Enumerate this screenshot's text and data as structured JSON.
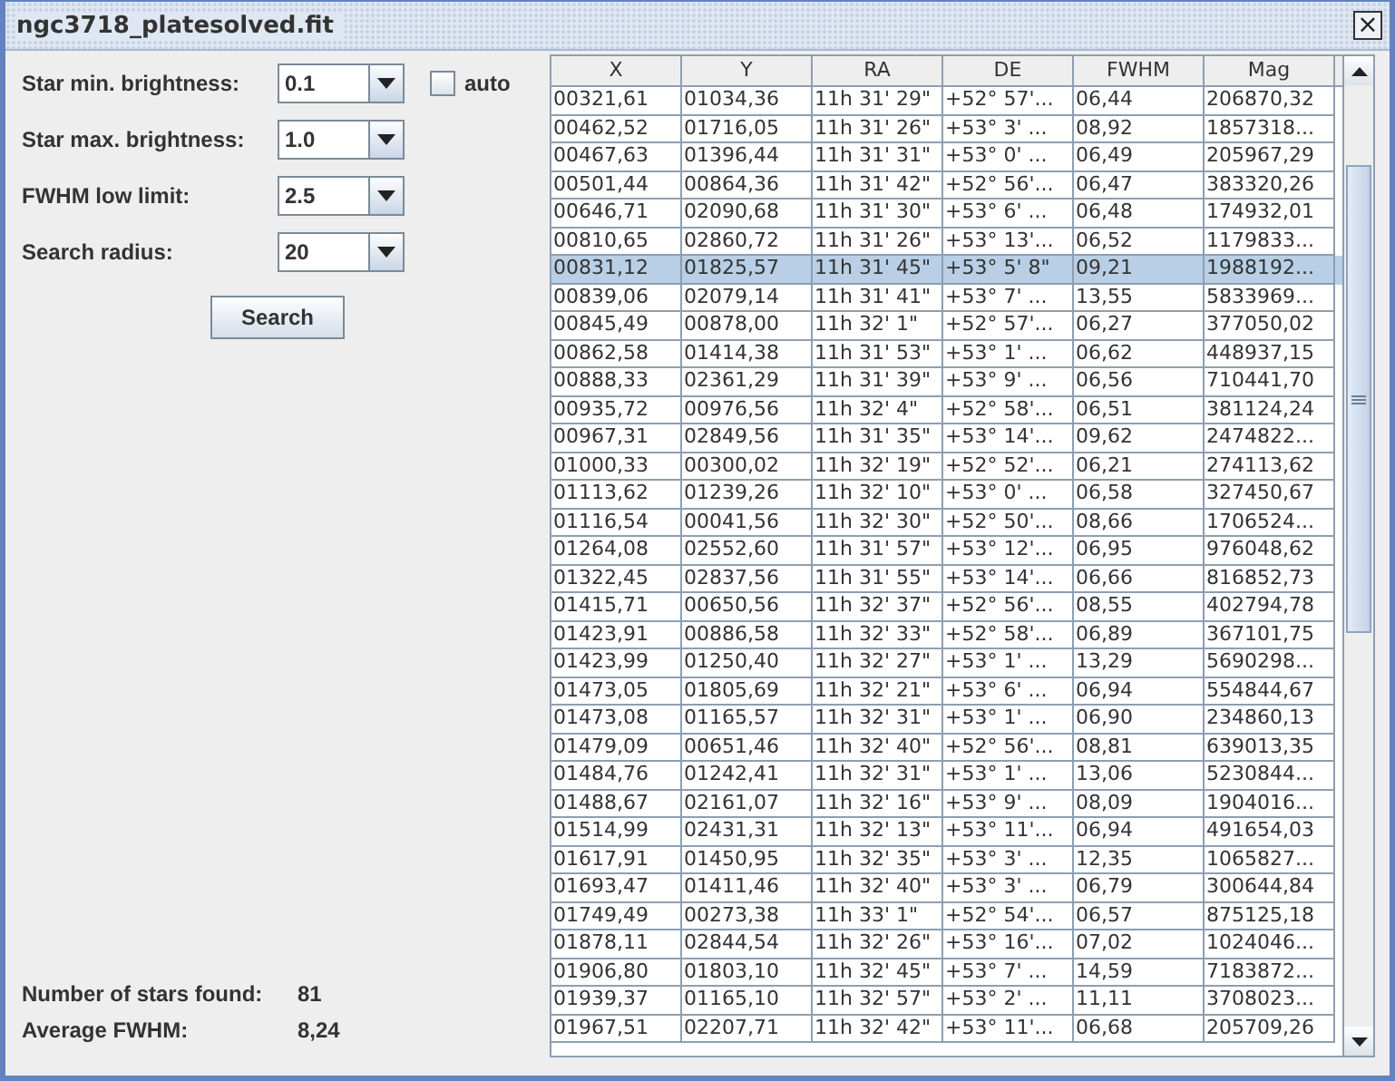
{
  "window": {
    "title": "ngc3718_platesolved.fit",
    "close_glyph": "×"
  },
  "settings": [
    {
      "label": "Star min. brightness:",
      "value": "0.1"
    },
    {
      "label": "Star max. brightness:",
      "value": "1.0"
    },
    {
      "label": "FWHM low limit:",
      "value": "2.5"
    },
    {
      "label": "Search radius:",
      "value": "20"
    }
  ],
  "auto_checkbox": {
    "label": "auto",
    "checked": false
  },
  "search_button": "Search",
  "summary": [
    {
      "label": "Number of stars found:",
      "value": "81"
    },
    {
      "label": "Average FWHM:",
      "value": "8,24"
    }
  ],
  "table": {
    "columns": [
      "X",
      "Y",
      "RA",
      "DE",
      "FWHM",
      "Mag"
    ],
    "rows": [
      {
        "cells": [
          "00321,61",
          "01034,36",
          "11h 31' 29\"",
          "+52° 57'...",
          "06,44",
          "206870,32"
        ],
        "selected": false
      },
      {
        "cells": [
          "00462,52",
          "01716,05",
          "11h 31' 26\"",
          "+53° 3' ...",
          "08,92",
          "1857318..."
        ],
        "selected": false
      },
      {
        "cells": [
          "00467,63",
          "01396,44",
          "11h 31' 31\"",
          "+53° 0' ...",
          "06,49",
          "205967,29"
        ],
        "selected": false
      },
      {
        "cells": [
          "00501,44",
          "00864,36",
          "11h 31' 42\"",
          "+52° 56'...",
          "06,47",
          "383320,26"
        ],
        "selected": false
      },
      {
        "cells": [
          "00646,71",
          "02090,68",
          "11h 31' 30\"",
          "+53° 6' ...",
          "06,48",
          "174932,01"
        ],
        "selected": false
      },
      {
        "cells": [
          "00810,65",
          "02860,72",
          "11h 31' 26\"",
          "+53° 13'...",
          "06,52",
          "1179833..."
        ],
        "selected": false
      },
      {
        "cells": [
          "00831,12",
          "01825,57",
          "11h 31' 45\"",
          "+53° 5' 8\"",
          "09,21",
          "1988192..."
        ],
        "selected": true
      },
      {
        "cells": [
          "00839,06",
          "02079,14",
          "11h 31' 41\"",
          "+53° 7' ...",
          "13,55",
          "5833969..."
        ],
        "selected": false
      },
      {
        "cells": [
          "00845,49",
          "00878,00",
          "11h 32' 1\"",
          "+52° 57'...",
          "06,27",
          "377050,02"
        ],
        "selected": false
      },
      {
        "cells": [
          "00862,58",
          "01414,38",
          "11h 31' 53\"",
          "+53° 1' ...",
          "06,62",
          "448937,15"
        ],
        "selected": false
      },
      {
        "cells": [
          "00888,33",
          "02361,29",
          "11h 31' 39\"",
          "+53° 9' ...",
          "06,56",
          "710441,70"
        ],
        "selected": false
      },
      {
        "cells": [
          "00935,72",
          "00976,56",
          "11h 32' 4\"",
          "+52° 58'...",
          "06,51",
          "381124,24"
        ],
        "selected": false
      },
      {
        "cells": [
          "00967,31",
          "02849,56",
          "11h 31' 35\"",
          "+53° 14'...",
          "09,62",
          "2474822..."
        ],
        "selected": false
      },
      {
        "cells": [
          "01000,33",
          "00300,02",
          "11h 32' 19\"",
          "+52° 52'...",
          "06,21",
          "274113,62"
        ],
        "selected": false
      },
      {
        "cells": [
          "01113,62",
          "01239,26",
          "11h 32' 10\"",
          "+53° 0' ...",
          "06,58",
          "327450,67"
        ],
        "selected": false
      },
      {
        "cells": [
          "01116,54",
          "00041,56",
          "11h 32' 30\"",
          "+52° 50'...",
          "08,66",
          "1706524..."
        ],
        "selected": false
      },
      {
        "cells": [
          "01264,08",
          "02552,60",
          "11h 31' 57\"",
          "+53° 12'...",
          "06,95",
          "976048,62"
        ],
        "selected": false
      },
      {
        "cells": [
          "01322,45",
          "02837,56",
          "11h 31' 55\"",
          "+53° 14'...",
          "06,66",
          "816852,73"
        ],
        "selected": false
      },
      {
        "cells": [
          "01415,71",
          "00650,56",
          "11h 32' 37\"",
          "+52° 56'...",
          "08,55",
          "402794,78"
        ],
        "selected": false
      },
      {
        "cells": [
          "01423,91",
          "00886,58",
          "11h 32' 33\"",
          "+52° 58'...",
          "06,89",
          "367101,75"
        ],
        "selected": false
      },
      {
        "cells": [
          "01423,99",
          "01250,40",
          "11h 32' 27\"",
          "+53° 1' ...",
          "13,29",
          "5690298..."
        ],
        "selected": false
      },
      {
        "cells": [
          "01473,05",
          "01805,69",
          "11h 32' 21\"",
          "+53° 6' ...",
          "06,94",
          "554844,67"
        ],
        "selected": false
      },
      {
        "cells": [
          "01473,08",
          "01165,57",
          "11h 32' 31\"",
          "+53° 1' ...",
          "06,90",
          "234860,13"
        ],
        "selected": false
      },
      {
        "cells": [
          "01479,09",
          "00651,46",
          "11h 32' 40\"",
          "+52° 56'...",
          "08,81",
          "639013,35"
        ],
        "selected": false
      },
      {
        "cells": [
          "01484,76",
          "01242,41",
          "11h 32' 31\"",
          "+53° 1' ...",
          "13,06",
          "5230844..."
        ],
        "selected": false
      },
      {
        "cells": [
          "01488,67",
          "02161,07",
          "11h 32' 16\"",
          "+53° 9' ...",
          "08,09",
          "1904016..."
        ],
        "selected": false
      },
      {
        "cells": [
          "01514,99",
          "02431,31",
          "11h 32' 13\"",
          "+53° 11'...",
          "06,94",
          "491654,03"
        ],
        "selected": false
      },
      {
        "cells": [
          "01617,91",
          "01450,95",
          "11h 32' 35\"",
          "+53° 3' ...",
          "12,35",
          "1065827..."
        ],
        "selected": false
      },
      {
        "cells": [
          "01693,47",
          "01411,46",
          "11h 32' 40\"",
          "+53° 3' ...",
          "06,79",
          "300644,84"
        ],
        "selected": false
      },
      {
        "cells": [
          "01749,49",
          "00273,38",
          "11h 33' 1\"",
          "+52° 54'...",
          "06,57",
          "875125,18"
        ],
        "selected": false
      },
      {
        "cells": [
          "01878,11",
          "02844,54",
          "11h 32' 26\"",
          "+53° 16'...",
          "07,02",
          "1024046..."
        ],
        "selected": false
      },
      {
        "cells": [
          "01906,80",
          "01803,10",
          "11h 32' 45\"",
          "+53° 7' ...",
          "14,59",
          "7183872..."
        ],
        "selected": false
      },
      {
        "cells": [
          "01939,37",
          "01165,10",
          "11h 32' 57\"",
          "+53° 2' ...",
          "11,11",
          "3708023..."
        ],
        "selected": false
      },
      {
        "cells": [
          "01967,51",
          "02207,71",
          "11h 32' 42\"",
          "+53° 11'...",
          "06,68",
          "205709,26"
        ],
        "selected": false
      }
    ]
  }
}
